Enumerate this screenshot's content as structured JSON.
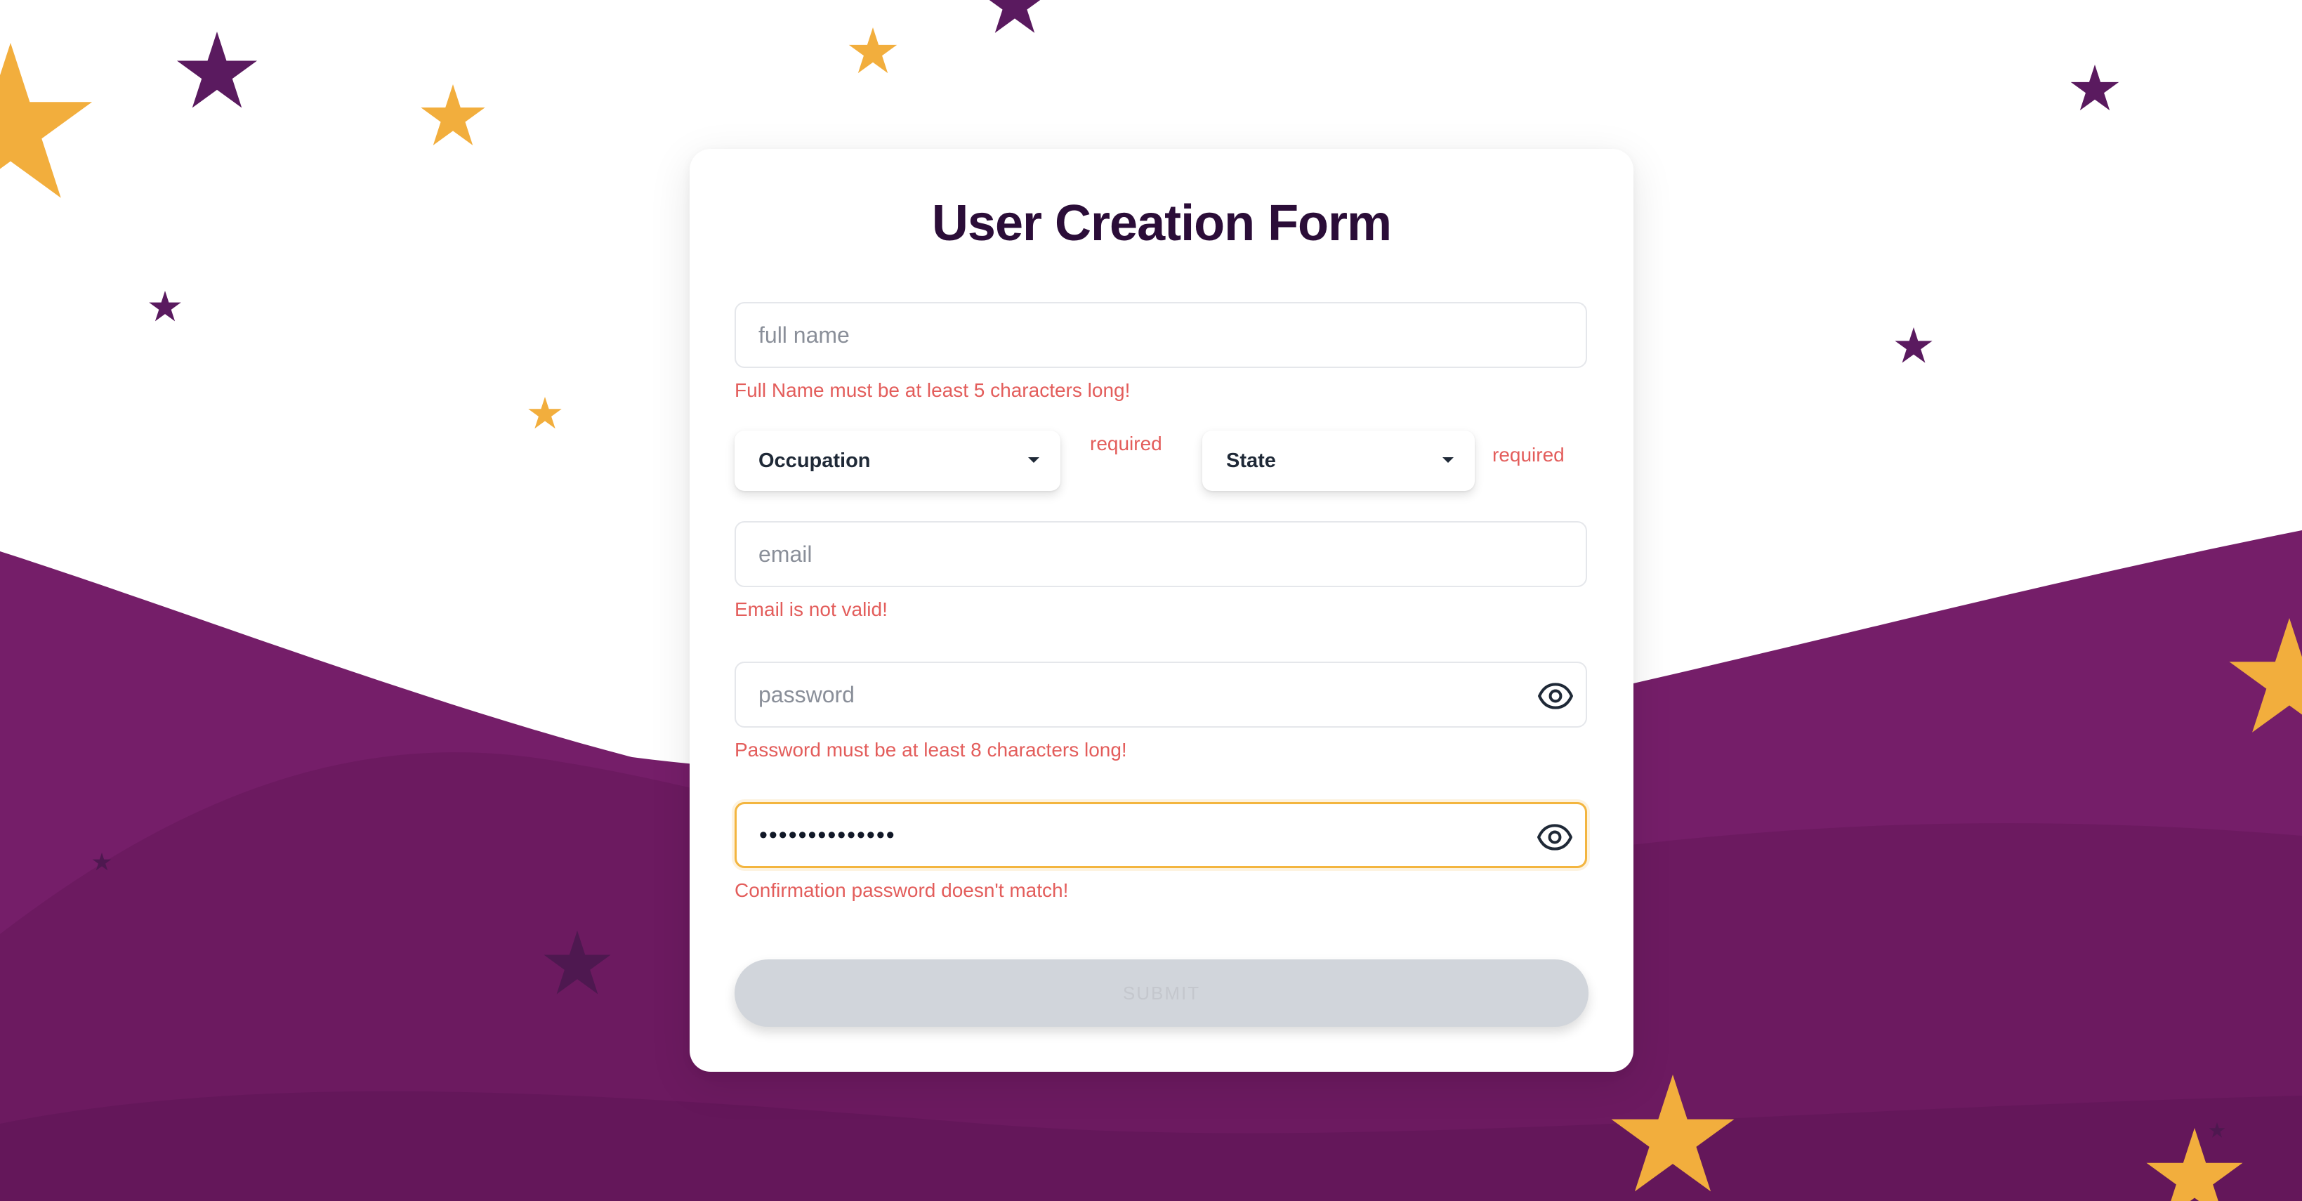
{
  "form": {
    "title": "User Creation Form",
    "full_name": {
      "placeholder": "full name",
      "value": "",
      "error": "Full Name must be at least 5 characters long!"
    },
    "occupation": {
      "label": "Occupation",
      "error": "required"
    },
    "state": {
      "label": "State",
      "error": "required"
    },
    "email": {
      "placeholder": "email",
      "value": "",
      "error": "Email is not valid!"
    },
    "password": {
      "placeholder": "password",
      "value": "",
      "error": "Password must be at least 8 characters long!",
      "toggle_icon": "eye-icon"
    },
    "confirm_password": {
      "value": "••••••••••••••",
      "error": "Confirmation password doesn't match!",
      "toggle_icon": "eye-icon"
    },
    "submit_label": "SUBMIT"
  },
  "colors": {
    "title": "#2b0d38",
    "error": "#e35d5b",
    "focus_border": "#f3b53f",
    "background_wave": "#731c66",
    "star_gold": "#f2ae3d",
    "star_purple": "#5a1a5f",
    "submit_disabled": "#d1d5db"
  }
}
